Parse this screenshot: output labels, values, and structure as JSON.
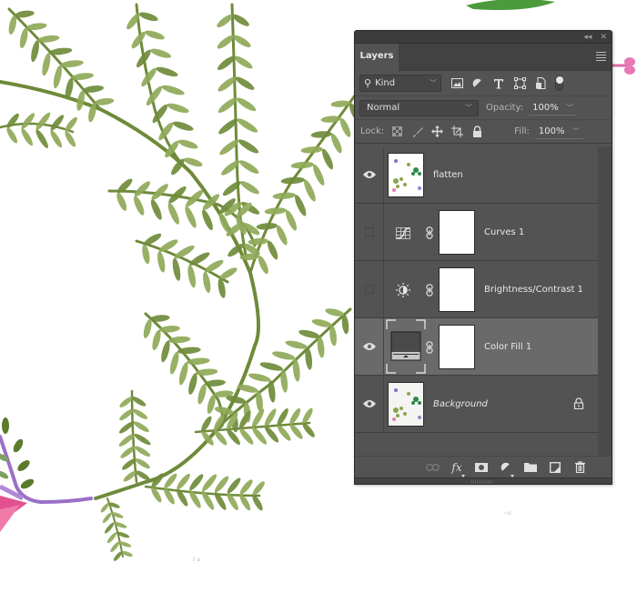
{
  "panel": {
    "title_buttons": {
      "collapse": "◂◂",
      "close": "✕"
    },
    "tab_label": "Layers",
    "menu_icon": "hamburger-menu-icon"
  },
  "filter": {
    "kind_label": "Kind",
    "kind_icon": "search-icon",
    "icons": [
      "pixel-layer-filter-icon",
      "adjustment-layer-filter-icon",
      "type-layer-filter-icon",
      "shape-layer-filter-icon",
      "smart-object-filter-icon",
      "filter-toggle"
    ]
  },
  "blend": {
    "mode": "Normal",
    "opacity_label": "Opacity:",
    "opacity_value": "100%"
  },
  "lock": {
    "label": "Lock:",
    "icons": [
      "lock-transparent-pixels-icon",
      "lock-image-pixels-icon",
      "lock-position-icon",
      "lock-artboard-icon",
      "lock-all-icon"
    ],
    "fill_label": "Fill:",
    "fill_value": "100%"
  },
  "layers": [
    {
      "name": "flatten",
      "visible": true,
      "type": "pixel",
      "selected": false,
      "italic": false,
      "locked": false
    },
    {
      "name": "Curves 1",
      "visible": false,
      "type": "curves",
      "selected": false,
      "italic": false,
      "locked": false
    },
    {
      "name": "Brightness/Contrast 1",
      "visible": false,
      "type": "brightness-contrast",
      "selected": false,
      "italic": false,
      "locked": false
    },
    {
      "name": "Color Fill 1",
      "visible": true,
      "type": "color-fill",
      "selected": true,
      "italic": false,
      "locked": false
    },
    {
      "name": "Background",
      "visible": true,
      "type": "pixel",
      "selected": false,
      "italic": true,
      "locked": true
    }
  ],
  "bottom_bar": {
    "icons": [
      "link-layers-icon",
      "layer-style-fx-icon",
      "add-mask-icon",
      "new-adjustment-layer-icon",
      "new-group-icon",
      "new-layer-icon",
      "delete-layer-icon"
    ],
    "fx_label": "fx"
  },
  "colors": {
    "panel_bg": "#535353",
    "selected_row": "#6a6a6a",
    "fern_green": "#7f9a45",
    "stem_purple": "#9b6fc4",
    "flower_pink": "#e8559a"
  }
}
